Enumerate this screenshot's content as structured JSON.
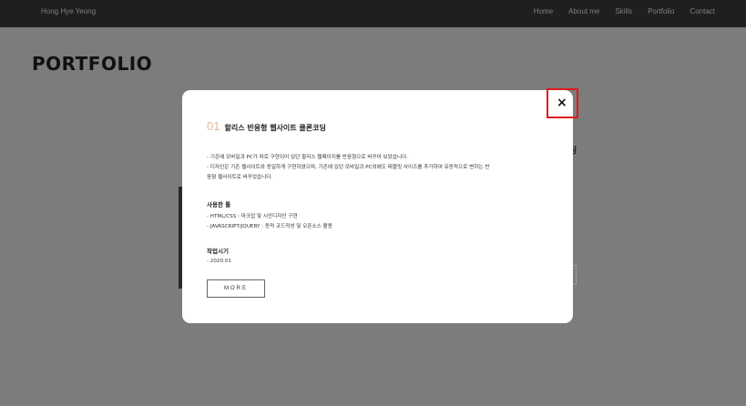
{
  "nav": {
    "brand": "Hong Hye Yeong",
    "items": [
      "Home",
      "About me",
      "Skills",
      "Portfolio",
      "Contact"
    ]
  },
  "page": {
    "title": "PORTFOLIO",
    "bg_heading_fragment": "딩"
  },
  "modal": {
    "number": "01",
    "title": "할리스 반응형 웹사이트 클론코딩",
    "description": [
      "- 기존에 모바일과 PC가 따로 구현되어 있던 할리스 웹페이지를 반응형으로 바꾸어 보았습니다.",
      "- 디자인은 기존 웹사이트와 동일하게 구현하였으며, 기존에 있던 모바일과 PC외에도 태블릿 사이즈를 추가하여 유동적으로 변하는 반",
      "응형 웹사이트로 바꾸었습니다."
    ],
    "tools_heading": "사용한 툴",
    "tools": [
      "- HTML/CSS : 마크업 및 시안디자인 구현",
      "- JAVASCRIPT/JQUERY : 동적 코드작성 및 오픈소스 활용"
    ],
    "period_heading": "작업시기",
    "period": "- 2020.01",
    "more_label": "MORE",
    "close_label": "×"
  }
}
